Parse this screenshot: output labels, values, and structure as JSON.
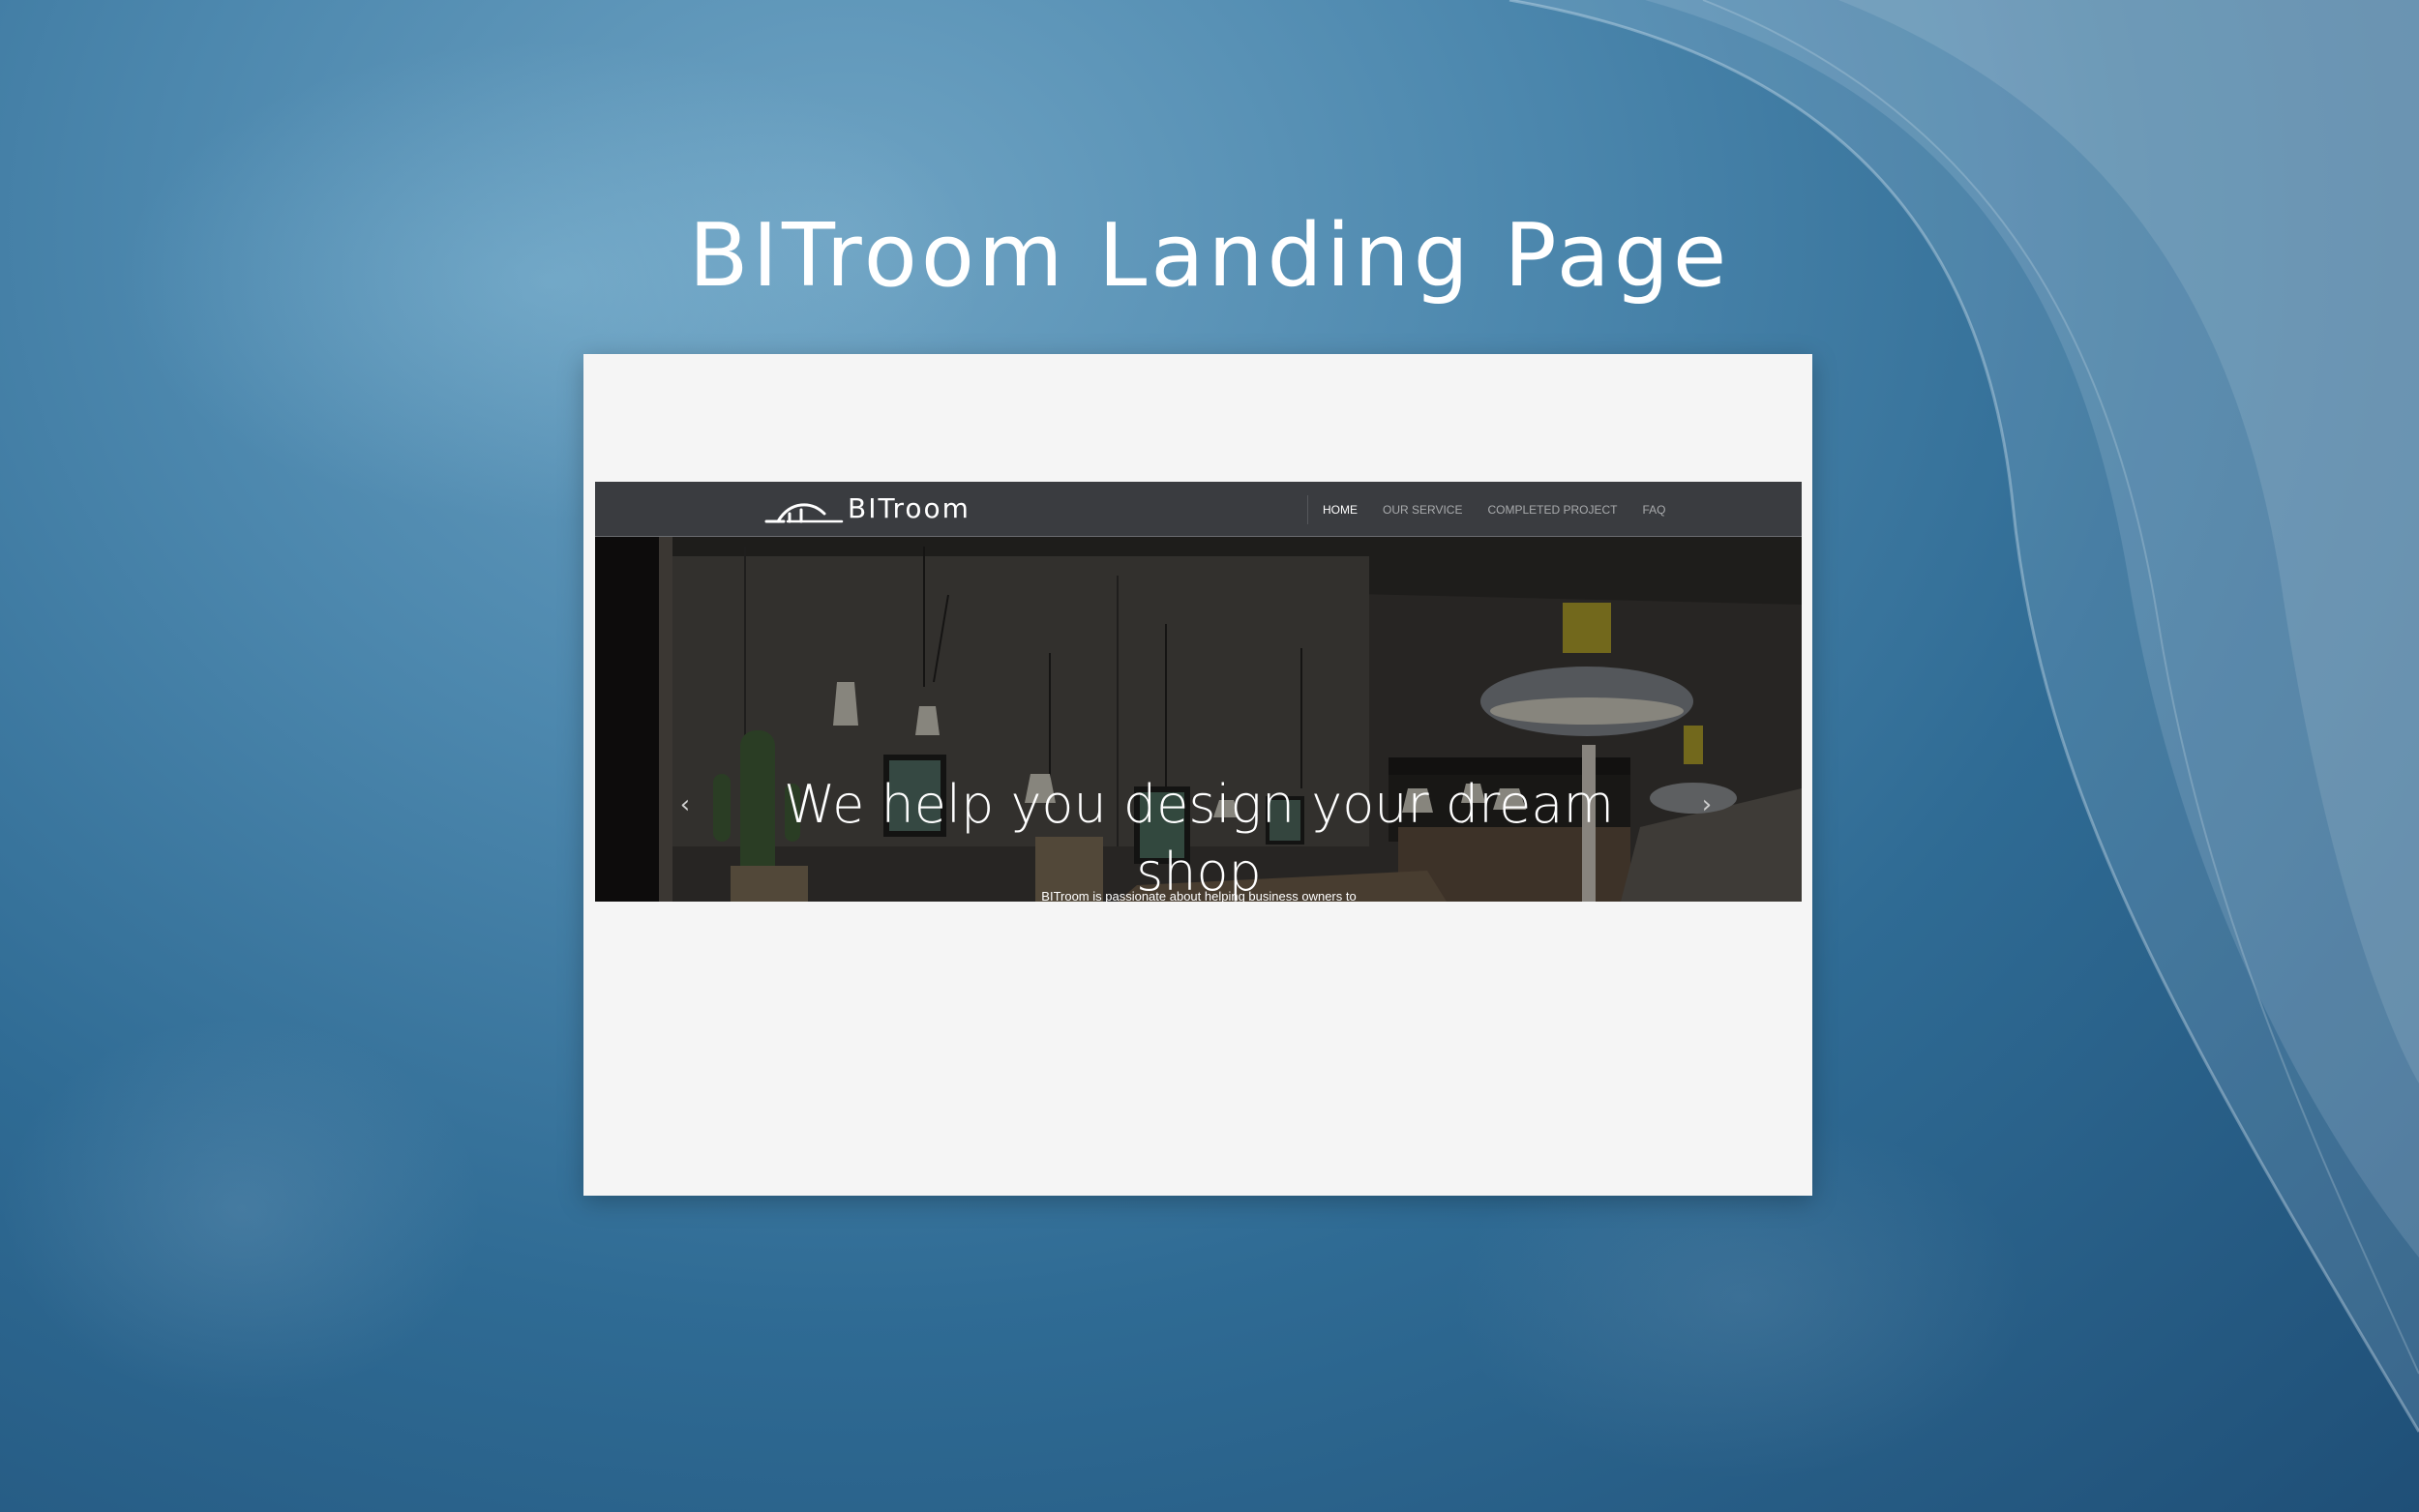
{
  "page": {
    "title": "BITroom Landing Page"
  },
  "site": {
    "logo_text": "BITroom",
    "nav": {
      "items": [
        {
          "label": "HOME",
          "active": true
        },
        {
          "label": "OUR SERVICE",
          "active": false
        },
        {
          "label": "COMPLETED PROJECT",
          "active": false
        },
        {
          "label": "FAQ",
          "active": false
        }
      ]
    },
    "hero": {
      "heading": "We help you design your dream shop",
      "subheading": "BITroom is passionate about helping business owners to",
      "prev_icon": "chevron-left-icon",
      "next_icon": "chevron-right-icon"
    }
  },
  "colors": {
    "background_blue": "#3f7ba3",
    "navbar": "#3a3c40",
    "frame": "#f5f5f5",
    "nav_active": "#ffffff",
    "nav_inactive": "#a9abad"
  }
}
